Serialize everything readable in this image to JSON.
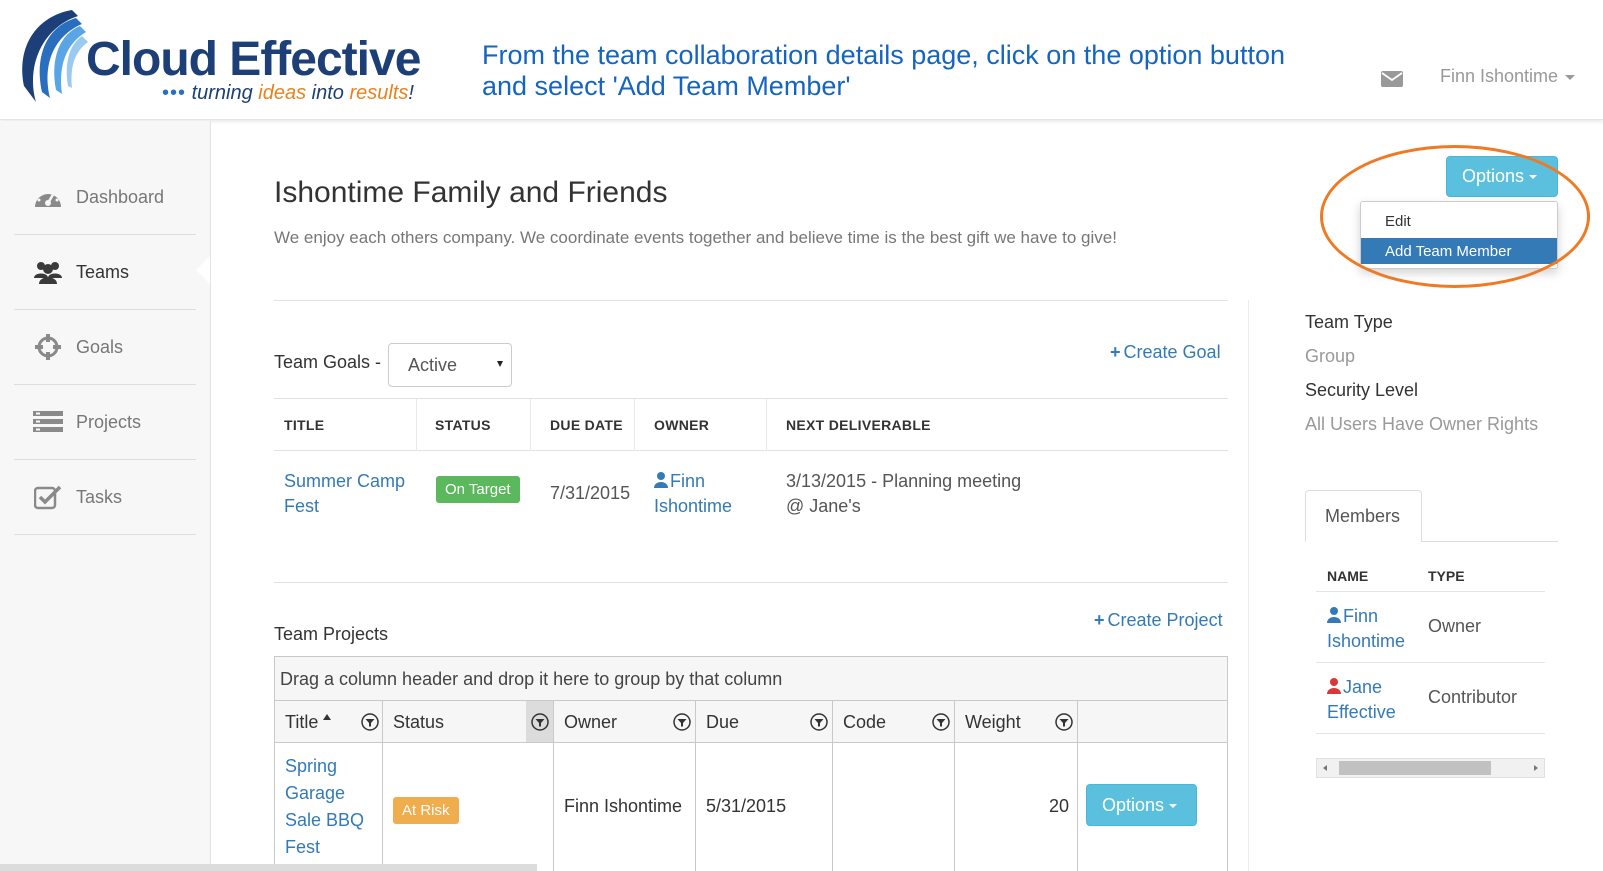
{
  "header": {
    "logo_name": "Cloud Effective",
    "logo_tagline_prefix": "turning ",
    "logo_tagline_accent1": "ideas",
    "logo_tagline_mid": " into ",
    "logo_tagline_accent2": "results",
    "logo_tagline_suffix": "!",
    "instruction_line1": "From the team collaboration details page, click on the option button",
    "instruction_line2": "and select 'Add Team Member'",
    "user_name": "Finn Ishontime"
  },
  "sidebar": {
    "items": [
      {
        "label": "Dashboard",
        "icon": "dashboard-icon"
      },
      {
        "label": "Teams",
        "icon": "users-icon"
      },
      {
        "label": "Goals",
        "icon": "crosshairs-icon"
      },
      {
        "label": "Projects",
        "icon": "list-icon"
      },
      {
        "label": "Tasks",
        "icon": "check-square-icon"
      }
    ],
    "active": "Teams"
  },
  "team": {
    "title": "Ishontime Family and Friends",
    "description": "We enjoy each others company. We coordinate events together and believe time is the best gift we have to give!"
  },
  "goals": {
    "label": "Team Goals -",
    "filter_value": "Active",
    "create_label": "Create Goal",
    "columns": [
      "TITLE",
      "STATUS",
      "DUE DATE",
      "OWNER",
      "NEXT DELIVERABLE"
    ],
    "rows": [
      {
        "title_line1": "Summer Camp",
        "title_line2": "Fest",
        "status": "On Target",
        "due": "7/31/2015",
        "owner_line1": "Finn",
        "owner_line2": "Ishontime",
        "deliverable_line1": "3/13/2015 - Planning meeting",
        "deliverable_line2": "@ Jane's"
      }
    ]
  },
  "projects": {
    "label": "Team Projects",
    "create_label": "Create Project",
    "group_hint": "Drag a column header and drop it here to group by that column",
    "columns": [
      "Title",
      "Status",
      "Owner",
      "Due",
      "Code",
      "Weight"
    ],
    "rows": [
      {
        "title_lines": [
          "Spring",
          "Garage",
          "Sale BBQ",
          "Fest"
        ],
        "status": "At Risk",
        "owner": "Finn Ishontime",
        "due": "5/31/2015",
        "code": "",
        "weight": "20",
        "options_label": "Options"
      }
    ]
  },
  "right_panel": {
    "options_label": "Options",
    "dropdown": [
      "Edit",
      "Add Team Member"
    ],
    "dropdown_highlighted": "Add Team Member",
    "team_type_label": "Team Type",
    "team_type_value": "Group",
    "security_label": "Security Level",
    "security_value": "All Users Have Owner Rights",
    "members_tab": "Members",
    "members_columns": [
      "NAME",
      "TYPE"
    ],
    "members": [
      {
        "name_line1": "Finn",
        "name_line2": "Ishontime",
        "type": "Owner",
        "color": "#337ab7"
      },
      {
        "name_line1": "Jane",
        "name_line2": "Effective",
        "type": "Contributor",
        "color": "#d9383a"
      }
    ]
  },
  "colors": {
    "link": "#337ab7",
    "instruction": "#1565c0",
    "success": "#5cb85c",
    "warning": "#f0ad4e",
    "info_button": "#5bc0de",
    "highlight_ring": "#f07a24"
  }
}
